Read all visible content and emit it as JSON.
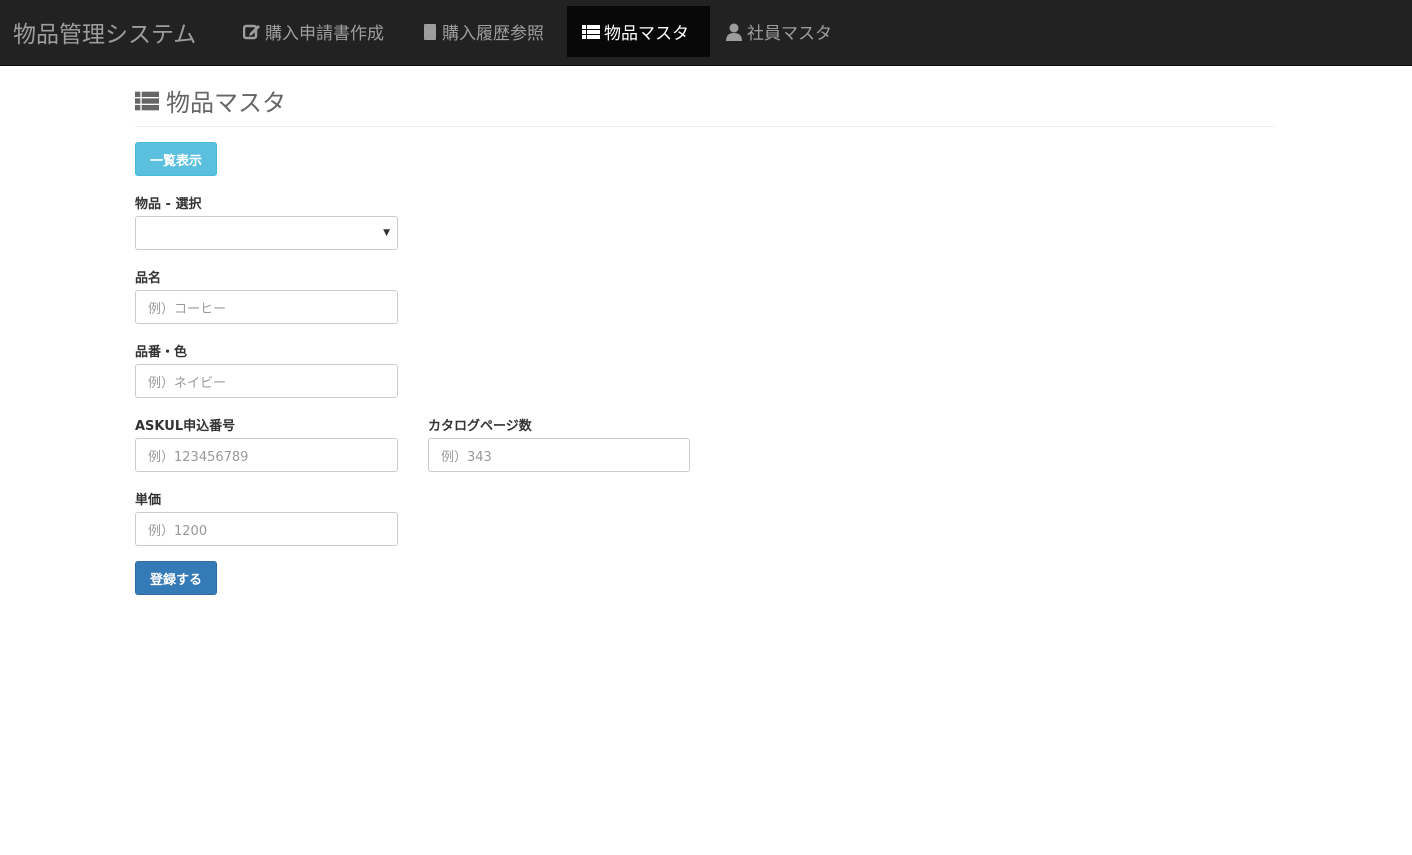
{
  "nav": {
    "brand": "物品管理システム",
    "items": [
      {
        "label": "購入申請書作成",
        "icon": "edit-icon"
      },
      {
        "label": "購入履歴参照",
        "icon": "book-icon"
      },
      {
        "label": "物品マスタ",
        "icon": "list-icon",
        "active": true
      },
      {
        "label": "社員マスタ",
        "icon": "user-icon"
      }
    ]
  },
  "page": {
    "title": "物品マスタ",
    "list_button": "一覧表示",
    "submit_button": "登録する"
  },
  "form": {
    "select": {
      "label": "物品 - 選択",
      "value": "",
      "arrow": "▼"
    },
    "name": {
      "label": "品名",
      "placeholder": "例）コーヒー"
    },
    "color": {
      "label": "品番・色",
      "placeholder": "例）ネイビー"
    },
    "askul": {
      "label": "ASKUL申込番号",
      "placeholder": "例）123456789"
    },
    "catalog": {
      "label": "カタログページ数",
      "placeholder": "例）343"
    },
    "price": {
      "label": "単価",
      "placeholder": "例）1200"
    }
  },
  "colors": {
    "navbar": "#222222",
    "info": "#5bc0de",
    "primary": "#337ab7"
  }
}
